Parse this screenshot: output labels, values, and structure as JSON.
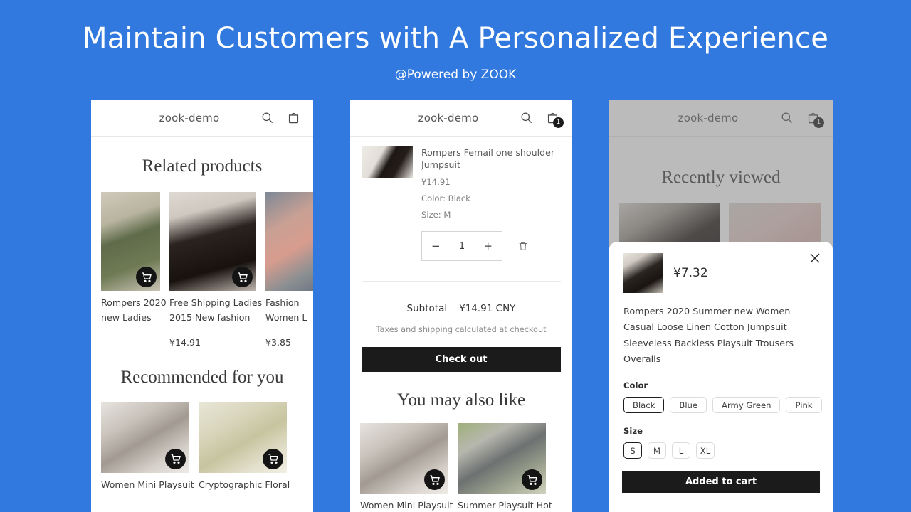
{
  "hero": {
    "title": "Maintain Customers with A Personalized Experience",
    "subtitle": "@Powered by ZOOK"
  },
  "colors": {
    "background": "#3179de",
    "button": "#1b1b1b",
    "text": "#3d3d3d"
  },
  "shop": {
    "name": "zook-demo"
  },
  "icons": {
    "menu": "hamburger-menu-icon",
    "search": "search-icon",
    "cart": "shopping-bag-icon",
    "close": "close-icon",
    "trash": "trash-icon",
    "add_to_cart": "cart-plus-icon"
  },
  "panel1": {
    "header": {
      "shop": "zook-demo",
      "cart_count": ""
    },
    "related": {
      "title": "Related products",
      "products": [
        {
          "name_line1": "Rompers 2020",
          "name_line2": "new Ladies",
          "price": ""
        },
        {
          "name_line1": "Free Shipping Ladies",
          "name_line2": "2015 New fashion",
          "price": "¥14.91"
        },
        {
          "name_line1": "Fashion",
          "name_line2": "Women L",
          "price": "¥3.85"
        }
      ]
    },
    "recommended": {
      "title": "Recommended for you",
      "products": [
        {
          "name": "Women Mini Playsuit"
        },
        {
          "name": "Cryptographic Floral"
        }
      ]
    }
  },
  "panel2": {
    "header": {
      "shop": "zook-demo",
      "cart_count": "1"
    },
    "cart_item": {
      "title": "Rompers Femail one shoulder Jumpsuit",
      "price": "¥14.91",
      "color": "Color: Black",
      "size": "Size: M",
      "minus": "−",
      "quantity": "1",
      "plus": "+"
    },
    "summary": {
      "subtotal_label": "Subtotal",
      "subtotal_value": "¥14.91 CNY",
      "tax_note": "Taxes and shipping calculated at checkout",
      "checkout_label": "Check out"
    },
    "also_like": {
      "title": "You may also like",
      "products": [
        {
          "name": "Women Mini Playsuit"
        },
        {
          "name": "Summer Playsuit Hot"
        }
      ]
    }
  },
  "panel3": {
    "header": {
      "shop": "zook-demo",
      "cart_count": "1"
    },
    "recently_viewed": {
      "title": "Recently viewed"
    },
    "popup": {
      "price": "¥7.32",
      "description": "Rompers 2020 Summer new Women Casual Loose Linen Cotton Jumpsuit Sleeveless Backless Playsuit Trousers Overalls",
      "color_label": "Color",
      "colors": [
        "Black",
        "Blue",
        "Army Green",
        "Pink"
      ],
      "color_selected": "Black",
      "size_label": "Size",
      "sizes": [
        "S",
        "M",
        "L",
        "XL"
      ],
      "size_selected": "S",
      "cta_label": "Added to cart"
    }
  }
}
